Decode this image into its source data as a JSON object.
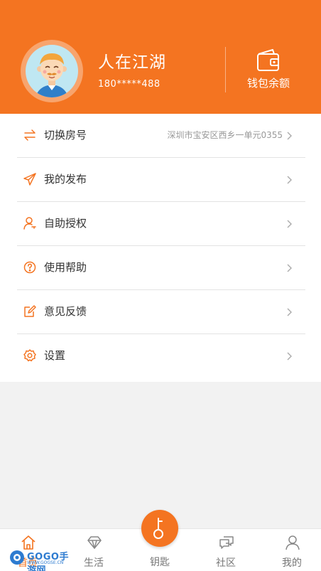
{
  "profile": {
    "username": "人在江湖",
    "phone": "180*****488",
    "wallet_label": "钱包余额"
  },
  "menu": [
    {
      "label": "切换房号",
      "value": "深圳市宝安区西乡一单元0355",
      "icon": "switch-arrows-icon"
    },
    {
      "label": "我的发布",
      "value": "",
      "icon": "send-plane-icon"
    },
    {
      "label": "自助授权",
      "value": "",
      "icon": "user-key-icon"
    },
    {
      "label": "使用帮助",
      "value": "",
      "icon": "help-circle-icon"
    },
    {
      "label": "意见反馈",
      "value": "",
      "icon": "edit-note-icon"
    },
    {
      "label": "设置",
      "value": "",
      "icon": "gear-icon"
    }
  ],
  "tabs": [
    {
      "label": "首页",
      "icon": "home-icon",
      "active": true
    },
    {
      "label": "生活",
      "icon": "diamond-icon",
      "active": false
    },
    {
      "label": "钥匙",
      "icon": "key-icon",
      "active": false
    },
    {
      "label": "社区",
      "icon": "chat-bubbles-icon",
      "active": false
    },
    {
      "label": "我的",
      "icon": "person-icon",
      "active": false
    }
  ],
  "watermark": {
    "title": "GOGO手游网",
    "subtitle": "WWW.GOGSE.CN"
  },
  "colors": {
    "accent": "#f47421",
    "text": "#333333",
    "muted": "#999999"
  }
}
